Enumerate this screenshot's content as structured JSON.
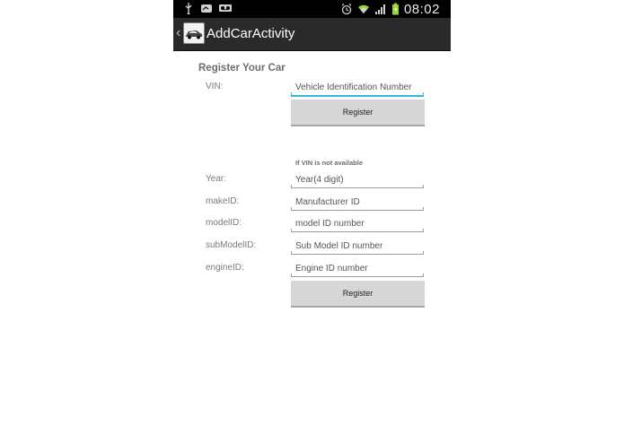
{
  "status_bar": {
    "left_icons": [
      "usb-icon",
      "mail-icon",
      "voicemail-icon"
    ],
    "right_icons": [
      "alarm-icon",
      "wifi-icon",
      "signal-icon",
      "battery-icon"
    ],
    "clock": "08:02"
  },
  "action_bar": {
    "title": "AddCarActivity",
    "app_icon": "car-icon"
  },
  "form": {
    "section_title": "Register Your Car",
    "vin": {
      "label": "VIN:",
      "placeholder": "Vehicle Identification Number"
    },
    "register_button_1": "Register",
    "note": "If VIN is not available",
    "year": {
      "label": "Year:",
      "placeholder": "Year(4 digit)"
    },
    "make": {
      "label": "makeID:",
      "placeholder": "Manufacturer ID"
    },
    "model": {
      "label": "modelID:",
      "placeholder": "model ID number"
    },
    "submodel": {
      "label": "subModelID:",
      "placeholder": "Sub Model ID number"
    },
    "engine": {
      "label": "engineID:",
      "placeholder": "Engine ID number"
    },
    "register_button_2": "Register"
  },
  "colors": {
    "status_bar_bg": "#000000",
    "action_bar_bg": "#2a2a2a",
    "focus_accent": "#33b5e5",
    "button_bg": "#d6d6d6"
  }
}
